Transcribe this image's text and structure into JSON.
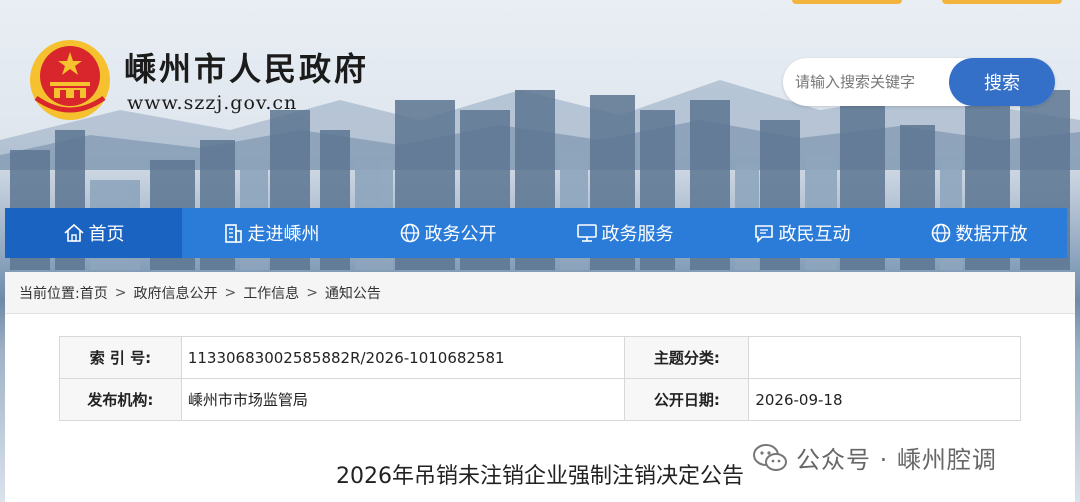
{
  "header": {
    "site_title": "嵊州市人民政府",
    "site_url": "www.szzj.gov.cn"
  },
  "search": {
    "placeholder": "请输入搜索关键字",
    "button_label": "搜索"
  },
  "nav": {
    "items": [
      {
        "label": "首页",
        "icon": "home-icon"
      },
      {
        "label": "走进嵊州",
        "icon": "building-icon"
      },
      {
        "label": "政务公开",
        "icon": "globe-icon"
      },
      {
        "label": "政务服务",
        "icon": "monitor-icon"
      },
      {
        "label": "政民互动",
        "icon": "chat-icon"
      },
      {
        "label": "数据开放",
        "icon": "globe-icon"
      }
    ]
  },
  "breadcrumb": {
    "prefix": "当前位置:",
    "items": [
      "首页",
      "政府信息公开",
      "工作信息",
      "通知公告"
    ],
    "separator": ">"
  },
  "info_table": {
    "index_label": "索 引 号:",
    "index_value": "11330683002585882R/2026-1010682581",
    "topic_label": "主题分类:",
    "topic_value": "",
    "publisher_label": "发布机构:",
    "publisher_value": "嵊州市市场监管局",
    "date_label": "公开日期:",
    "date_value": "2026-09-18"
  },
  "document": {
    "title": "2026年吊销未注销企业强制注销决定公告"
  },
  "watermark": {
    "text": "公众号 · 嵊州腔调"
  },
  "colors": {
    "nav_blue": "#2a7cd8",
    "nav_active": "#1a63c0",
    "search_button": "#3470c8",
    "emblem_red": "#d8262c",
    "emblem_gold": "#f5c12e"
  }
}
